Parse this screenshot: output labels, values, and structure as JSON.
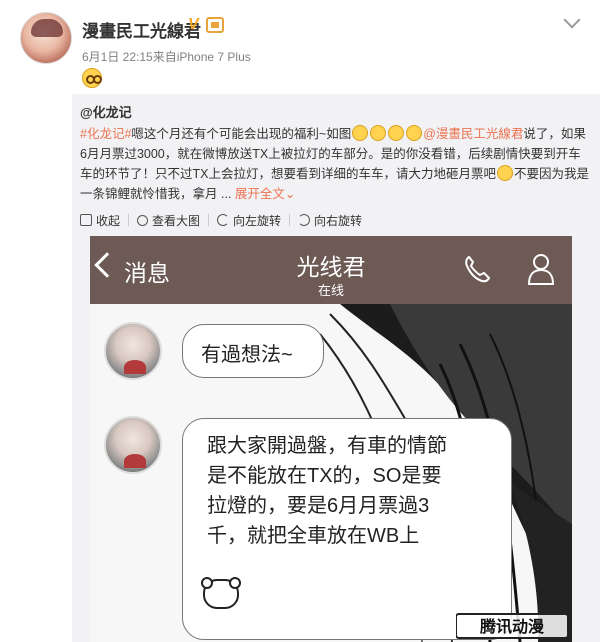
{
  "post": {
    "username": "漫畫民工光線君",
    "meta": "6月1日 22:15来自iPhone 7 Plus"
  },
  "repost": {
    "author": "@化龙记",
    "hashtag": "#化龙记#",
    "text_part1": "嗯这个月还有个可能会出现的福利~如图",
    "mention": "@漫畫民工光線君",
    "text_part2": "说了，如果6月月票过3000，就在微博放送TX上被拉灯的车部分。是的你没看错，后续剧情快要到开车车的环节了！只不过TX上会拉灯，想要看到详细的车车，请大力地砸月票吧",
    "text_part3": "不要因为我是一条锦鲤就怜惜我，拿月 ...",
    "more_label": "展开全文",
    "chevron_glyph": "⌄"
  },
  "toolbar": {
    "collapse_label": "收起",
    "zoom_label": "查看大图",
    "rotate_left_label": "向左旋转",
    "rotate_right_label": "向右旋转"
  },
  "chat": {
    "back_label": "消息",
    "title": "光线君",
    "subtitle": "在线",
    "message_1": "有過想法~",
    "message_2_lines": [
      "跟大家開過盤，有車的情節",
      "是不能放在TX的，SO是要",
      "拉燈的，要是6月月票過3",
      "千，就把全車放在WB上"
    ],
    "watermark_text": "腾讯动漫"
  },
  "colors": {
    "accent": "#eb7350",
    "chat_header": "#6d5a55",
    "repost_bg": "#f2f2f5"
  },
  "icons": [
    "verified-icon",
    "member-icon",
    "chevron-down-icon",
    "back-icon",
    "phone-icon",
    "user-icon",
    "bear-icon"
  ]
}
